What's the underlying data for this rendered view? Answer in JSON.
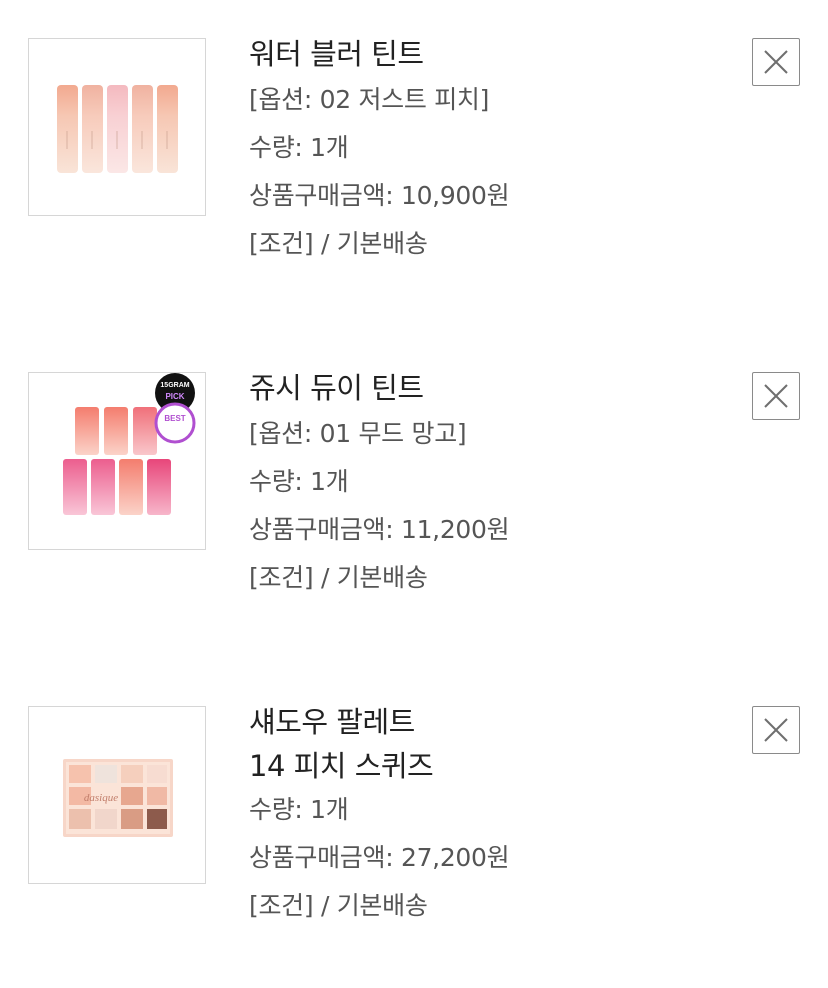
{
  "cart": {
    "items": [
      {
        "name_lines": [
          "워터 블러 틴트"
        ],
        "option": "[옵션: 02 저스트 피치]",
        "quantity": "수량: 1개",
        "price": "상품구매금액: 10,900원",
        "shipping": "[조건] / 기본배송",
        "image_icon": "lip-tint-tubes-image",
        "remove_icon": "close-icon"
      },
      {
        "name_lines": [
          "쥬시 듀이 틴트"
        ],
        "option": "[옵션: 01 무드 망고]",
        "quantity": "수량: 1개",
        "price": "상품구매금액: 11,200원",
        "shipping": "[조건] / 기본배송",
        "image_icon": "lip-tint-bottles-image",
        "badges": [
          "15GRAM",
          "PICK",
          "BEST"
        ],
        "remove_icon": "close-icon"
      },
      {
        "name_lines": [
          "섀도우 팔레트",
          "14 피치 스퀴즈"
        ],
        "quantity": "수량: 1개",
        "price": "상품구매금액: 27,200원",
        "shipping": "[조건] / 기본배송",
        "image_icon": "eyeshadow-palette-image",
        "palette_brand": "dasique",
        "remove_icon": "close-icon"
      }
    ]
  },
  "colors": {
    "title": "#222222",
    "meta": "#555555",
    "border": "#d6d6d6"
  }
}
